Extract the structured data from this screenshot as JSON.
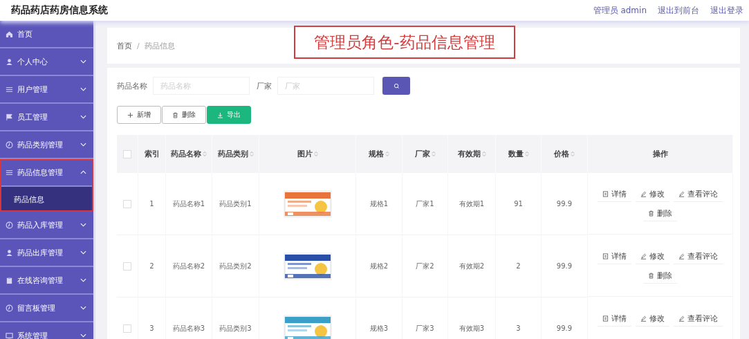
{
  "header": {
    "title": "药品药店药房信息系统",
    "links": [
      "管理员 admin",
      "退出到前台",
      "退出登录"
    ]
  },
  "sidebar": {
    "items": [
      {
        "label": "首页",
        "kind": "link",
        "selected": false
      },
      {
        "label": "个人中心",
        "kind": "menu",
        "expanded": false,
        "highlighted": false
      },
      {
        "label": "用户管理",
        "kind": "menu",
        "expanded": false,
        "highlighted": false
      },
      {
        "label": "员工管理",
        "kind": "menu",
        "expanded": false,
        "highlighted": false
      },
      {
        "label": "药品类别管理",
        "kind": "menu",
        "expanded": false,
        "highlighted": false
      },
      {
        "label": "药品信息管理",
        "kind": "menu",
        "expanded": true,
        "highlighted": true,
        "children": [
          {
            "label": "药品信息",
            "selected": true
          }
        ]
      },
      {
        "label": "药品入库管理",
        "kind": "menu",
        "expanded": false,
        "highlighted": false
      },
      {
        "label": "药品出库管理",
        "kind": "menu",
        "expanded": false,
        "highlighted": false
      },
      {
        "label": "在线咨询管理",
        "kind": "menu",
        "expanded": false,
        "highlighted": false
      },
      {
        "label": "留言板管理",
        "kind": "menu",
        "expanded": false,
        "highlighted": false
      },
      {
        "label": "系统管理",
        "kind": "menu",
        "expanded": false,
        "highlighted": false
      }
    ]
  },
  "breadcrumb": {
    "items": [
      "首页",
      "药品信息"
    ],
    "separator": "/"
  },
  "annotation": {
    "text": "管理员角色-药品信息管理"
  },
  "search": {
    "fields": [
      {
        "label": "药品名称",
        "placeholder": "药品名称"
      },
      {
        "label": "厂家",
        "placeholder": "厂家"
      }
    ]
  },
  "toolbar": [
    {
      "label": "新增",
      "kind": "add"
    },
    {
      "label": "删除",
      "kind": "delete"
    },
    {
      "label": "导出",
      "kind": "export"
    }
  ],
  "table": {
    "select_all": {
      "checked": false
    },
    "columns": [
      {
        "label": "索引",
        "sortable": false
      },
      {
        "label": "药品名称",
        "sortable": true
      },
      {
        "label": "药品类别",
        "sortable": true
      },
      {
        "label": "图片",
        "sortable": true
      },
      {
        "label": "规格",
        "sortable": true
      },
      {
        "label": "厂家",
        "sortable": true
      },
      {
        "label": "有效期",
        "sortable": true
      },
      {
        "label": "数量",
        "sortable": true
      },
      {
        "label": "价格",
        "sortable": true
      },
      {
        "label": "操作",
        "sortable": false
      }
    ],
    "rows": [
      {
        "checked": false,
        "cells": [
          "1",
          "药品名称1",
          "药品类别1"
        ],
        "image": {
          "kind": "picture"
        },
        "cells2": [
          "规格1",
          "厂家1",
          "有效期1",
          "91",
          "99.9"
        ],
        "actions": [
          {
            "label": "详情",
            "kind": "detail"
          },
          {
            "label": "修改",
            "kind": "edit"
          },
          {
            "label": "查看评论",
            "kind": "edit"
          },
          {
            "label": "删除",
            "kind": "delete"
          }
        ]
      },
      {
        "checked": false,
        "cells": [
          "2",
          "药品名称2",
          "药品类别2"
        ],
        "image": {
          "kind": "picture"
        },
        "cells2": [
          "规格2",
          "厂家2",
          "有效期2",
          "2",
          "99.9"
        ],
        "actions": [
          {
            "label": "详情",
            "kind": "detail"
          },
          {
            "label": "修改",
            "kind": "edit"
          },
          {
            "label": "查看评论",
            "kind": "edit"
          },
          {
            "label": "删除",
            "kind": "delete"
          }
        ]
      },
      {
        "checked": false,
        "cells": [
          "3",
          "药品名称3",
          "药品类别3"
        ],
        "image": {
          "kind": "picture"
        },
        "cells2": [
          "规格3",
          "厂家3",
          "有效期3",
          "3",
          "99.9"
        ],
        "actions": [
          {
            "label": "详情",
            "kind": "detail"
          },
          {
            "label": "修改",
            "kind": "edit"
          },
          {
            "label": "查看评论",
            "kind": "edit"
          }
        ]
      }
    ]
  }
}
